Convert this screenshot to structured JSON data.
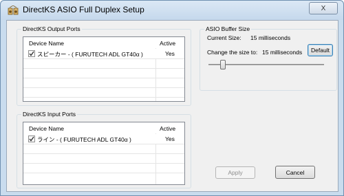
{
  "window": {
    "title": "DirectKS  ASIO Full Duplex Setup",
    "close_label": "X"
  },
  "output_ports": {
    "label": "DirectKS Output Ports",
    "columns": [
      "Device Name",
      "Active"
    ],
    "rows": [
      {
        "name": "スピーカー - ( FURUTECH ADL GT40α )",
        "active": "Yes",
        "checked": true
      }
    ]
  },
  "input_ports": {
    "label": "DirectKS Input Ports",
    "columns": [
      "Device Name",
      "Active"
    ],
    "rows": [
      {
        "name": "ライン - ( FURUTECH ADL GT40α )",
        "active": "Yes",
        "checked": true
      }
    ]
  },
  "asio_buffer": {
    "label": "ASIO Buffer Size",
    "current_size_label": "Current Size:",
    "current_size_value": "15 milliseconds",
    "change_label": "Change the size to:",
    "change_value": "15 milliseconds",
    "default_button": "Default",
    "slider_level": 0.1
  },
  "buttons": {
    "apply": "Apply",
    "cancel": "Cancel"
  },
  "colors": {
    "title_bar": "#c9dcee",
    "client_bg": "#f0f0f0",
    "default_button_border": "#3c7fb1"
  }
}
